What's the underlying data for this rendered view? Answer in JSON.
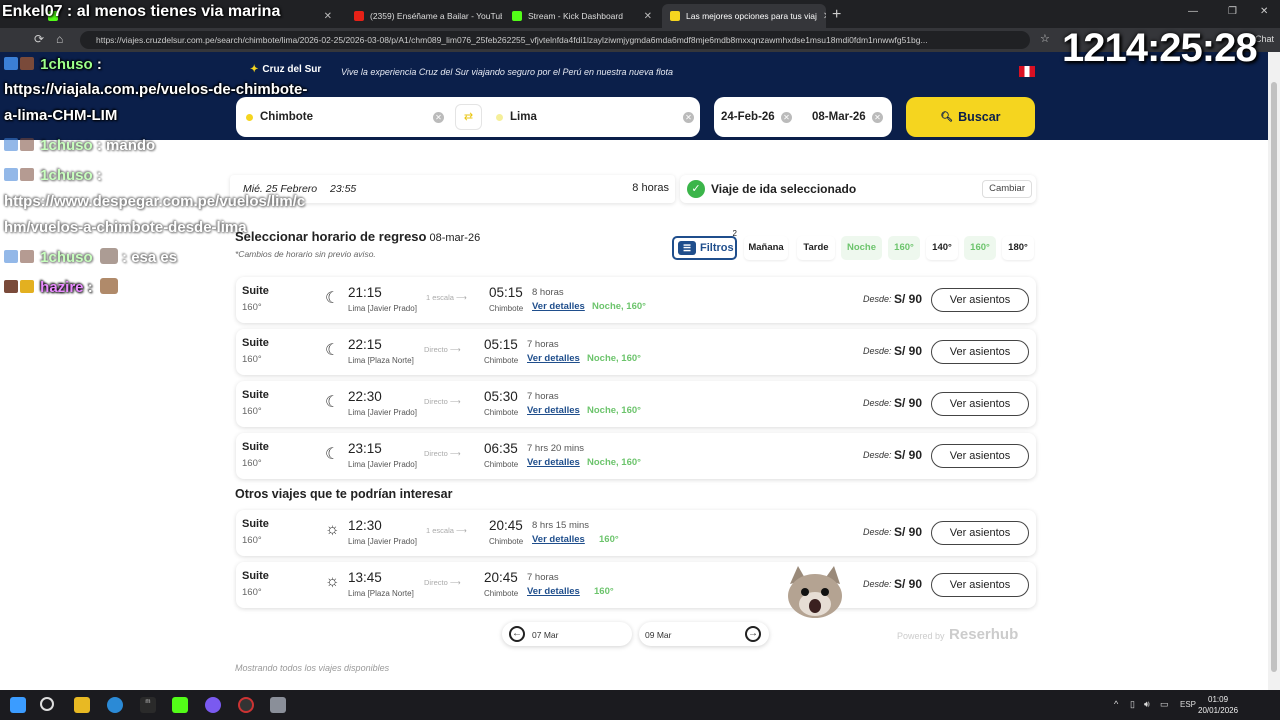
{
  "browser": {
    "tabs": [
      {
        "label": "Enkel07 : al menos tienes via marina",
        "active": false
      },
      {
        "label": "(2359) Enséñame a Bailar - YouTub",
        "active": false
      },
      {
        "label": "Stream - Kick Dashboard",
        "active": false
      },
      {
        "label": "Las mejores opciones para tus viaj",
        "active": true
      }
    ],
    "url": "https://viajes.cruzdelsur.com.pe/search/chimbote/lima/2026-02-25/2026-03-08/p/A1/chm089_lim076_25feb262255_vfjvtelnfda4fdi1lzaylziwmjygmda6mda6mdf8mje6mdb8mxxqnzawmhxdse1msu18mdi0fdm1nnwwfg51bg...",
    "profile_label": "Chat"
  },
  "overlay": {
    "timer": "1214:25:28",
    "chat": [
      {
        "user": "1chuso",
        "text": ":"
      },
      {
        "text": "https://viajala.com.pe/vuelos-de-chimbote-"
      },
      {
        "text": "a-lima-CHM-LIM"
      },
      {
        "user": "1chuso",
        "text": ": mando"
      },
      {
        "user": "1chuso",
        "text": ":"
      },
      {
        "text": "https://www.despegar.com.pe/vuelos/lim/c"
      },
      {
        "text": "hm/vuelos-a-chimbote-desde-lima"
      },
      {
        "user": "1chuso",
        "text": ": esa es"
      },
      {
        "user": "hazire",
        "text": ":"
      }
    ]
  },
  "header": {
    "brand": "Cruz del Sur",
    "tagline": "Vive la experiencia Cruz del Sur viajando seguro por el Perú en nuestra nueva flota",
    "origin": "Chimbote",
    "destination": "Lima",
    "date_out": "24-Feb-26",
    "date_return": "08-Mar-26",
    "search_label": "Buscar"
  },
  "outbound": {
    "date": "Mié. 25 Febrero",
    "time": "23:55",
    "duration": "8 horas",
    "selected_text": "Viaje de ida seleccionado",
    "change_label": "Cambiar"
  },
  "return_section": {
    "title": "Seleccionar horario de regreso",
    "date": "08-mar-26",
    "note": "*Cambios de horario sin previo aviso."
  },
  "filters": {
    "label": "Filtros",
    "count": "2",
    "chips": [
      {
        "label": "Mañana",
        "active": false
      },
      {
        "label": "Tarde",
        "active": false
      },
      {
        "label": "Noche",
        "active": true
      },
      {
        "label": "160°",
        "active": true
      },
      {
        "label": "140°",
        "active": false
      },
      {
        "label": "160°",
        "active": true
      },
      {
        "label": "180°",
        "active": false
      }
    ]
  },
  "trips": [
    {
      "service": "Suite",
      "degree": "160°",
      "period": "night",
      "dep": "21:15",
      "from": "Lima [Javier Prado]",
      "stops": "1 escala",
      "arr": "05:15",
      "to": "Chimbote",
      "duration": "8 horas",
      "details": "Ver detalles",
      "tag": "Noche, 160°",
      "from_label": "Desde:",
      "price": "S/ 90",
      "seats": "Ver asientos"
    },
    {
      "service": "Suite",
      "degree": "160°",
      "period": "night",
      "dep": "22:15",
      "from": "Lima [Plaza Norte]",
      "stops": "Directo",
      "arr": "05:15",
      "to": "Chimbote",
      "duration": "7 horas",
      "details": "Ver detalles",
      "tag": "Noche, 160°",
      "from_label": "Desde:",
      "price": "S/ 90",
      "seats": "Ver asientos"
    },
    {
      "service": "Suite",
      "degree": "160°",
      "period": "night",
      "dep": "22:30",
      "from": "Lima [Javier Prado]",
      "stops": "Directo",
      "arr": "05:30",
      "to": "Chimbote",
      "duration": "7 horas",
      "details": "Ver detalles",
      "tag": "Noche, 160°",
      "from_label": "Desde:",
      "price": "S/ 90",
      "seats": "Ver asientos"
    },
    {
      "service": "Suite",
      "degree": "160°",
      "period": "night",
      "dep": "23:15",
      "from": "Lima [Javier Prado]",
      "stops": "Directo",
      "arr": "06:35",
      "to": "Chimbote",
      "duration": "7 hrs 20 mins",
      "details": "Ver detalles",
      "tag": "Noche, 160°",
      "from_label": "Desde:",
      "price": "S/ 90",
      "seats": "Ver asientos"
    }
  ],
  "other_title": "Otros viajes que te podrían interesar",
  "other_trips": [
    {
      "service": "Suite",
      "degree": "160°",
      "period": "day",
      "dep": "12:30",
      "from": "Lima [Javier Prado]",
      "stops": "1 escala",
      "arr": "20:45",
      "to": "Chimbote",
      "duration": "8 hrs 15 mins",
      "details": "Ver detalles",
      "tag": "160°",
      "from_label": "Desde:",
      "price": "S/ 90",
      "seats": "Ver asientos"
    },
    {
      "service": "Suite",
      "degree": "160°",
      "period": "day",
      "dep": "13:45",
      "from": "Lima [Plaza Norte]",
      "stops": "Directo",
      "arr": "20:45",
      "to": "Chimbote",
      "duration": "7 horas",
      "details": "Ver detalles",
      "tag": "160°",
      "from_label": "Desde:",
      "price": "S/ 90",
      "seats": "Ver asientos"
    }
  ],
  "pagination": {
    "prev": "07 Mar",
    "next": "09 Mar"
  },
  "powered_by": {
    "prefix": "Powered by",
    "name": "Reserhub"
  },
  "footer_note": "Mostrando todos los viajes disponibles",
  "taskbar": {
    "lang": "ESP",
    "time": "01:09",
    "date": "20/01/2026"
  },
  "colors": {
    "navy": "#0b1f4a",
    "yellow": "#f5d51f",
    "green": "#6cc46c",
    "link": "#1f4e8c"
  }
}
